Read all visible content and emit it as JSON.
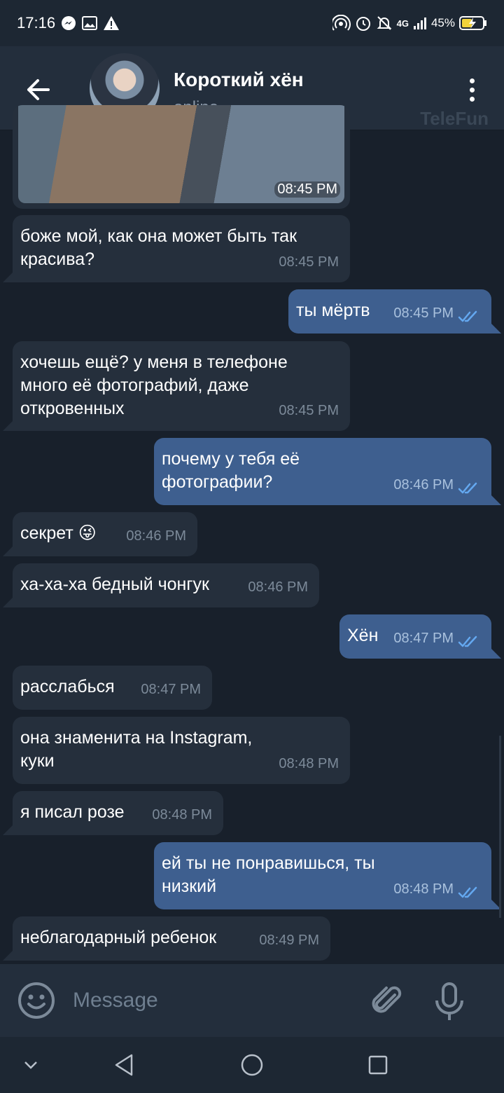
{
  "status_bar": {
    "time": "17:16",
    "battery": "45%",
    "network": "4G"
  },
  "header": {
    "title": "Короткий хён",
    "status": "online",
    "watermark": "TeleFun"
  },
  "photo_message": {
    "time": "08:45 PM"
  },
  "messages": [
    {
      "text": "боже мой, как она может быть так\nкрасива?",
      "time": "08:45 PM"
    },
    {
      "text": "ты мёртв",
      "time": "08:45 PM"
    },
    {
      "text": "хочешь ещё? у меня в телефоне\nмного её фотографий, даже\nоткровенных",
      "time": "08:45 PM"
    },
    {
      "text": "почему у тебя её\nфотографии?",
      "time": "08:46 PM"
    },
    {
      "text": "секрет 😜",
      "time": "08:46 PM"
    },
    {
      "text": "ха-ха-ха бедный чонгук",
      "time": "08:46 PM"
    },
    {
      "text": "Хён",
      "time": "08:47 PM"
    },
    {
      "text": "расслабься",
      "time": "08:47 PM"
    },
    {
      "text": "она знаменита на Instagram,\nкуки",
      "time": "08:48 PM"
    },
    {
      "text": "я писал розе",
      "time": "08:48 PM"
    },
    {
      "text": "ей ты не понравишься, ты\nнизкий",
      "time": "08:48 PM"
    },
    {
      "text": "неблагодарный ребенок",
      "time": "08:49 PM"
    }
  ],
  "input": {
    "placeholder": "Message"
  },
  "colors": {
    "background": "#18202b",
    "header": "#232e3c",
    "incoming_bubble": "#252f3c",
    "outgoing_bubble": "#3e5f8f",
    "read_check": "#64a8f0"
  },
  "icons": {
    "back": "arrow-left-icon",
    "menu": "more-vertical-icon",
    "emoji": "smile-icon",
    "attach": "paperclip-icon",
    "mic": "microphone-icon"
  }
}
